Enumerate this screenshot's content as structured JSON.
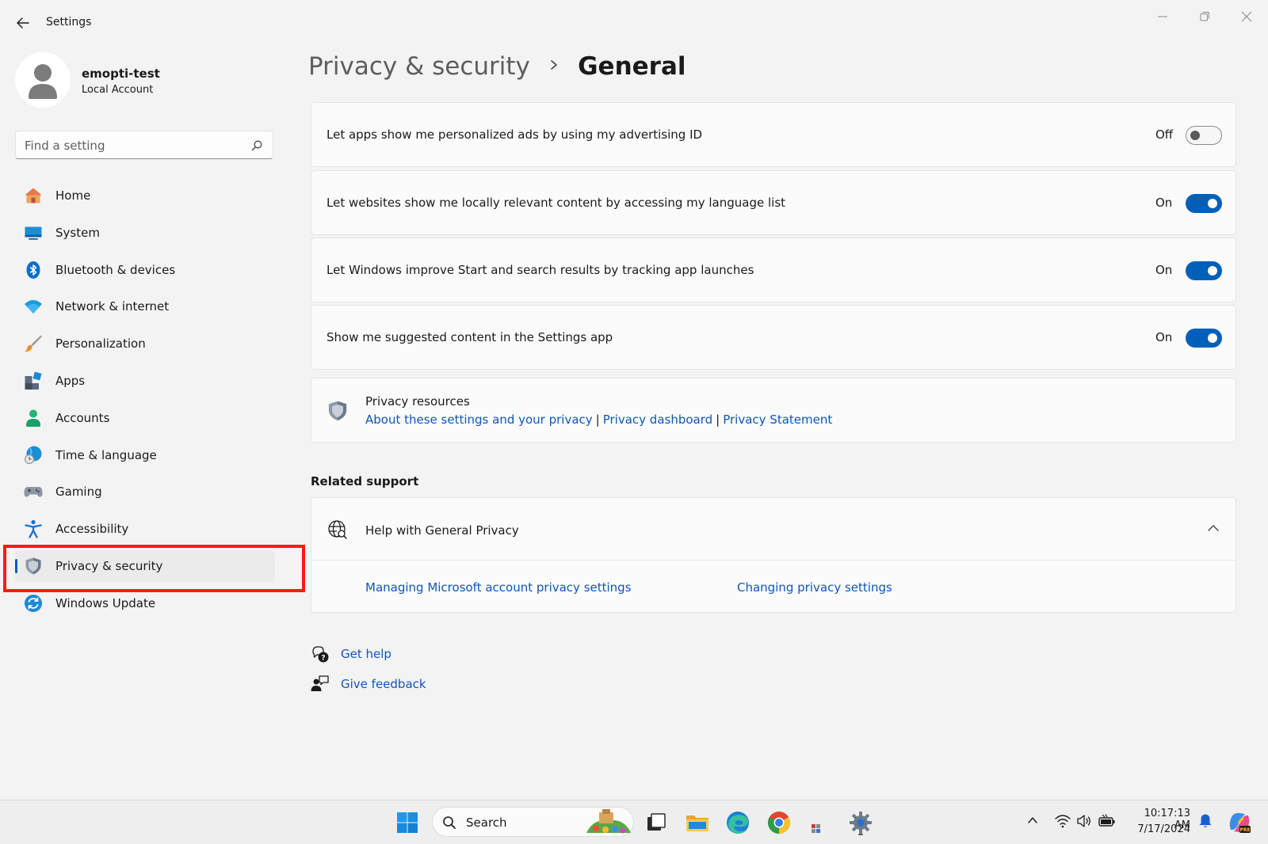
{
  "window": {
    "title": "Settings"
  },
  "user": {
    "name": "emopti-test",
    "account_type": "Local Account"
  },
  "search": {
    "placeholder": "Find a setting"
  },
  "nav": {
    "items": [
      {
        "label": "Home",
        "icon": "home-icon"
      },
      {
        "label": "System",
        "icon": "system-icon"
      },
      {
        "label": "Bluetooth & devices",
        "icon": "bluetooth-icon"
      },
      {
        "label": "Network & internet",
        "icon": "wifi-icon"
      },
      {
        "label": "Personalization",
        "icon": "brush-icon"
      },
      {
        "label": "Apps",
        "icon": "apps-icon"
      },
      {
        "label": "Accounts",
        "icon": "accounts-icon"
      },
      {
        "label": "Time & language",
        "icon": "globe-clock-icon"
      },
      {
        "label": "Gaming",
        "icon": "gamepad-icon"
      },
      {
        "label": "Accessibility",
        "icon": "accessibility-icon"
      },
      {
        "label": "Privacy & security",
        "icon": "shield-icon",
        "selected": true
      },
      {
        "label": "Windows Update",
        "icon": "update-icon"
      }
    ]
  },
  "breadcrumb": {
    "parent": "Privacy & security",
    "current": "General"
  },
  "settings": [
    {
      "label": "Let apps show me personalized ads by using my advertising ID",
      "state": "Off"
    },
    {
      "label": "Let websites show me locally relevant content by accessing my language list",
      "state": "On"
    },
    {
      "label": "Let Windows improve Start and search results by tracking app launches",
      "state": "On"
    },
    {
      "label": "Show me suggested content in the Settings app",
      "state": "On"
    }
  ],
  "privacy_resources": {
    "title": "Privacy resources",
    "links": [
      "About these settings and your privacy",
      "Privacy dashboard",
      "Privacy Statement"
    ]
  },
  "related_support": {
    "section_title": "Related support",
    "help_title": "Help with General Privacy",
    "links": [
      "Managing Microsoft account privacy settings",
      "Changing privacy settings"
    ]
  },
  "footer_links": {
    "get_help": "Get help",
    "give_feedback": "Give feedback"
  },
  "taskbar": {
    "search_label": "Search",
    "time": "10:17:13 AM",
    "date": "7/17/2024"
  },
  "colors": {
    "accent": "#005fb8",
    "link": "#0f56b3",
    "highlight": "#ff1a0e"
  }
}
